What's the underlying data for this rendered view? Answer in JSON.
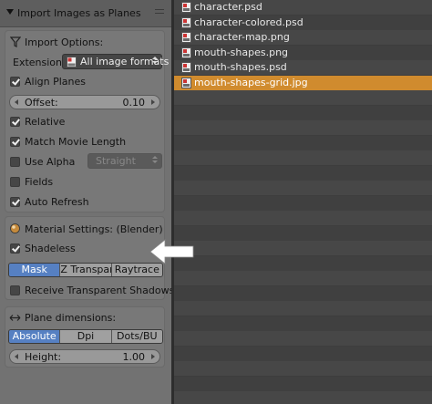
{
  "panel": {
    "title": "Import Images as Planes",
    "import_options": {
      "heading": "Import Options:",
      "extension_label": "Extension:",
      "extension_value": "All image formats",
      "align_planes": {
        "label": "Align Planes",
        "checked": true
      },
      "offset": {
        "label": "Offset:",
        "value": "0.10"
      },
      "relative": {
        "label": "Relative",
        "checked": true
      },
      "match_movie_length": {
        "label": "Match Movie Length",
        "checked": true
      },
      "use_alpha": {
        "label": "Use Alpha",
        "checked": false,
        "mode": "Straight"
      },
      "fields": {
        "label": "Fields",
        "checked": false
      },
      "auto_refresh": {
        "label": "Auto Refresh",
        "checked": true
      }
    },
    "material_settings": {
      "heading": "Material Settings: (Blender)",
      "shadeless": {
        "label": "Shadeless",
        "checked": true
      },
      "transparency_modes": [
        "Mask",
        "Z Transpare…",
        "Raytrace"
      ],
      "active_mode": "Mask",
      "receive_shadows": {
        "label": "Receive Transparent Shadows",
        "checked": false
      }
    },
    "plane_dimensions": {
      "heading": "Plane dimensions:",
      "modes": [
        "Absolute",
        "Dpi",
        "Dots/BU"
      ],
      "active_mode": "Absolute",
      "height": {
        "label": "Height:",
        "value": "1.00"
      }
    }
  },
  "files": [
    {
      "name": "character.psd",
      "selected": false
    },
    {
      "name": "character-colored.psd",
      "selected": false
    },
    {
      "name": "character-map.png",
      "selected": false
    },
    {
      "name": "mouth-shapes.png",
      "selected": false
    },
    {
      "name": "mouth-shapes.psd",
      "selected": false
    },
    {
      "name": "mouth-shapes-grid.jpg",
      "selected": true
    }
  ],
  "colors": {
    "selection": "#d08b2e",
    "active_button": "#5680c2",
    "panel_bg": "#727272"
  },
  "icons": [
    "funnel-icon",
    "image-file-icon",
    "material-sphere-icon",
    "resize-arrows-icon",
    "white-arrow-annotation"
  ]
}
